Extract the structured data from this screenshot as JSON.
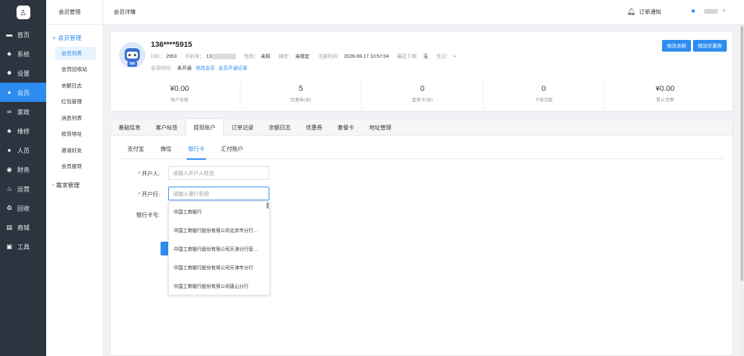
{
  "nav": {
    "items": [
      {
        "label": "首页",
        "icon": "monitor-icon",
        "glyph": "▬"
      },
      {
        "label": "系统",
        "icon": "sitemap-icon",
        "glyph": "♣"
      },
      {
        "label": "设置",
        "icon": "gear-icon",
        "glyph": "✹"
      },
      {
        "label": "会员",
        "icon": "user-icon",
        "glyph": "●"
      },
      {
        "label": "家政",
        "icon": "link-icon",
        "glyph": "∞"
      },
      {
        "label": "维修",
        "icon": "sitemap-icon",
        "glyph": "♣"
      },
      {
        "label": "人员",
        "icon": "user-icon",
        "glyph": "●"
      },
      {
        "label": "财务",
        "icon": "coin-icon",
        "glyph": "◉"
      },
      {
        "label": "运营",
        "icon": "fire-icon",
        "glyph": "♨"
      },
      {
        "label": "回收",
        "icon": "recycle-icon",
        "glyph": "♻"
      },
      {
        "label": "商城",
        "icon": "store-icon",
        "glyph": "▤"
      },
      {
        "label": "工具",
        "icon": "briefcase-icon",
        "glyph": "▣"
      }
    ],
    "active_index": 3
  },
  "submenu": {
    "header": "会员管理",
    "group_open": "会员管理",
    "items": [
      "会员列表",
      "会员回收站",
      "余额日志",
      "红包管理",
      "消息列表",
      "收货地址",
      "邀请好友",
      "会员提现"
    ],
    "active": "会员列表",
    "group_closed": "需求管理"
  },
  "topbar": {
    "page_title": "会员详情",
    "notification_label": "订单通知"
  },
  "profile": {
    "phone": "136****5915",
    "uid_label": "UID：",
    "uid": "2953",
    "mobile_label": "手机号：",
    "mobile_prefix": "13",
    "gender_label": "性别：",
    "gender": "未知",
    "wechat_label": "微信：",
    "wechat": "未绑定",
    "register_label": "注册时间：",
    "register_time": "2026-08-17 10:57:04",
    "last_order_label": "最近下单：",
    "last_order": "无",
    "birthday_label": "生日：",
    "birthday": "--",
    "member_time_label": "会员时间：",
    "member_time": "未开通",
    "modify_member_link": "修改会员",
    "member_record_link": "会员开通记录",
    "btn_modify_balance": "修改余额",
    "btn_gift_coupon": "赠送优惠券"
  },
  "stats": [
    {
      "value": "¥0.00",
      "label": "账户余额"
    },
    {
      "value": "5",
      "label": "优惠券(张)"
    },
    {
      "value": "0",
      "label": "套餐卡(张)"
    },
    {
      "value": "0",
      "label": "下单次数"
    },
    {
      "value": "¥0.00",
      "label": "累计消费"
    }
  ],
  "tabs": [
    "基础信息",
    "客户标签",
    "提现账户",
    "订单记录",
    "余额日志",
    "优惠券",
    "套餐卡",
    "地址管理"
  ],
  "active_tab": "提现账户",
  "subtabs": [
    "支付宝",
    "微信",
    "银行卡",
    "汇付账户"
  ],
  "active_subtab": "银行卡",
  "form": {
    "holder_label": "开户人:",
    "holder_placeholder": "请输入开户人姓名",
    "bank_label": "开户行:",
    "bank_placeholder": "请输入银行名称",
    "card_label": "银行卡号:"
  },
  "bank_options": [
    "中国工商银行",
    "中国工商银行股份有限公司北京市分行营...",
    "中国工商银行股份有限公司天津分行营业部",
    "中国工商银行股份有限公司天津市分行",
    "中国工商银行股份有限公司唐山分行"
  ],
  "colors": {
    "accent": "#2d8cf0",
    "nav_bg": "#2c3440",
    "required": "#ed4014"
  }
}
